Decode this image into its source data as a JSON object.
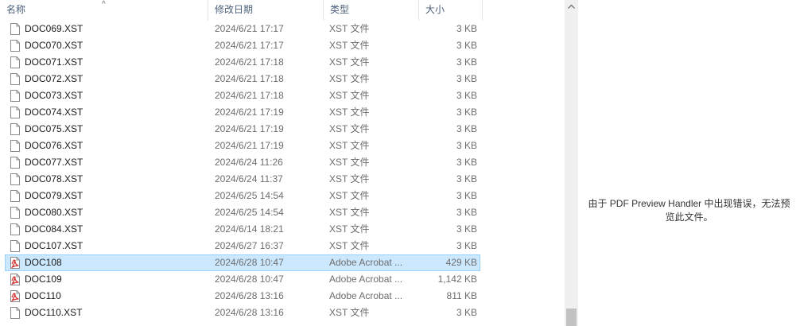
{
  "header": {
    "col_name": "名称",
    "col_date": "修改日期",
    "col_type": "类型",
    "col_size": "大小",
    "sort_icon": "chevron-up-icon"
  },
  "files": [
    {
      "name": "DOC069.XST",
      "date": "2024/6/21 17:17",
      "type": "XST 文件",
      "size": "3 KB",
      "icon": "document-icon"
    },
    {
      "name": "DOC070.XST",
      "date": "2024/6/21 17:17",
      "type": "XST 文件",
      "size": "3 KB",
      "icon": "document-icon"
    },
    {
      "name": "DOC071.XST",
      "date": "2024/6/21 17:18",
      "type": "XST 文件",
      "size": "3 KB",
      "icon": "document-icon"
    },
    {
      "name": "DOC072.XST",
      "date": "2024/6/21 17:18",
      "type": "XST 文件",
      "size": "3 KB",
      "icon": "document-icon"
    },
    {
      "name": "DOC073.XST",
      "date": "2024/6/21 17:18",
      "type": "XST 文件",
      "size": "3 KB",
      "icon": "document-icon"
    },
    {
      "name": "DOC074.XST",
      "date": "2024/6/21 17:19",
      "type": "XST 文件",
      "size": "3 KB",
      "icon": "document-icon"
    },
    {
      "name": "DOC075.XST",
      "date": "2024/6/21 17:19",
      "type": "XST 文件",
      "size": "3 KB",
      "icon": "document-icon"
    },
    {
      "name": "DOC076.XST",
      "date": "2024/6/21 17:19",
      "type": "XST 文件",
      "size": "3 KB",
      "icon": "document-icon"
    },
    {
      "name": "DOC077.XST",
      "date": "2024/6/24 11:26",
      "type": "XST 文件",
      "size": "3 KB",
      "icon": "document-icon"
    },
    {
      "name": "DOC078.XST",
      "date": "2024/6/24 11:37",
      "type": "XST 文件",
      "size": "3 KB",
      "icon": "document-icon"
    },
    {
      "name": "DOC079.XST",
      "date": "2024/6/25 14:54",
      "type": "XST 文件",
      "size": "3 KB",
      "icon": "document-icon"
    },
    {
      "name": "DOC080.XST",
      "date": "2024/6/25 14:54",
      "type": "XST 文件",
      "size": "3 KB",
      "icon": "document-icon"
    },
    {
      "name": "DOC084.XST",
      "date": "2024/6/14 18:21",
      "type": "XST 文件",
      "size": "3 KB",
      "icon": "document-icon"
    },
    {
      "name": "DOC107.XST",
      "date": "2024/6/27 16:37",
      "type": "XST 文件",
      "size": "3 KB",
      "icon": "document-icon"
    },
    {
      "name": "DOC108",
      "date": "2024/6/28 10:47",
      "type": "Adobe Acrobat ...",
      "size": "429 KB",
      "icon": "pdf-icon",
      "selected": true
    },
    {
      "name": "DOC109",
      "date": "2024/6/28 10:47",
      "type": "Adobe Acrobat ...",
      "size": "1,142 KB",
      "icon": "pdf-icon"
    },
    {
      "name": "DOC110",
      "date": "2024/6/28 13:16",
      "type": "Adobe Acrobat ...",
      "size": "811 KB",
      "icon": "pdf-icon"
    },
    {
      "name": "DOC110.XST",
      "date": "2024/6/28 13:16",
      "type": "XST 文件",
      "size": "3 KB",
      "icon": "document-icon"
    }
  ],
  "scrollbar": {
    "up_icon": "chevron-up-icon"
  },
  "preview": {
    "message_line1": "由于 PDF Preview Handler 中出现错误，无法预",
    "message_line2": "览此文件。"
  },
  "colors": {
    "selection_bg": "#cce8ff",
    "selection_border": "#99d1ff",
    "pdf_red": "#d32f2f"
  }
}
